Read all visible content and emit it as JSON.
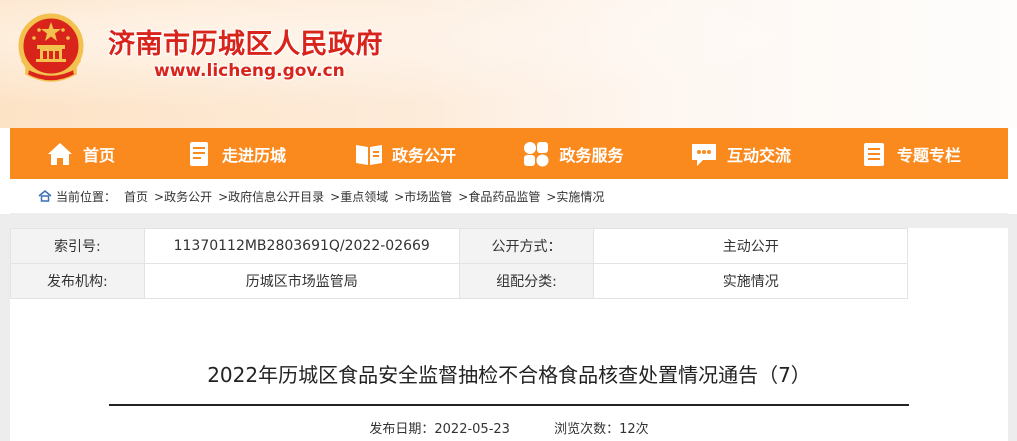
{
  "header": {
    "site_title": "济南市历城区人民政府",
    "site_url": "www.licheng.gov.cn",
    "emblem_icon": "national-emblem-icon",
    "brand_color": "#d9241b"
  },
  "nav": {
    "background": "#fb8a1e",
    "items": [
      {
        "label": "首页",
        "icon": "home-icon"
      },
      {
        "label": "走进历城",
        "icon": "document-icon"
      },
      {
        "label": "政务公开",
        "icon": "open-book-icon"
      },
      {
        "label": "政务服务",
        "icon": "grid-icon"
      },
      {
        "label": "互动交流",
        "icon": "chat-icon"
      },
      {
        "label": "专题专栏",
        "icon": "notes-icon"
      }
    ]
  },
  "breadcrumb": {
    "prefix": "当前位置：",
    "items": [
      "首页",
      ">政务公开",
      ">政府信息公开目录",
      ">重点领域",
      ">市场监管",
      ">食品药品监管",
      ">实施情况"
    ]
  },
  "meta": {
    "index_label": "索引号:",
    "index_value": "11370112MB2803691Q/2022-02669",
    "disclosure_label": "公开方式：",
    "disclosure_value": "主动公开",
    "publisher_label": "发布机构:",
    "publisher_value": "历城区市场监管局",
    "category_label": "组配分类:",
    "category_value": "实施情况"
  },
  "article": {
    "title": "2022年历城区食品安全监督抽检不合格食品核查处置情况通告（7）",
    "date_label": "发布日期：",
    "date_value": "2022-05-23",
    "views_label": "浏览次数：",
    "views_value": "12次"
  }
}
